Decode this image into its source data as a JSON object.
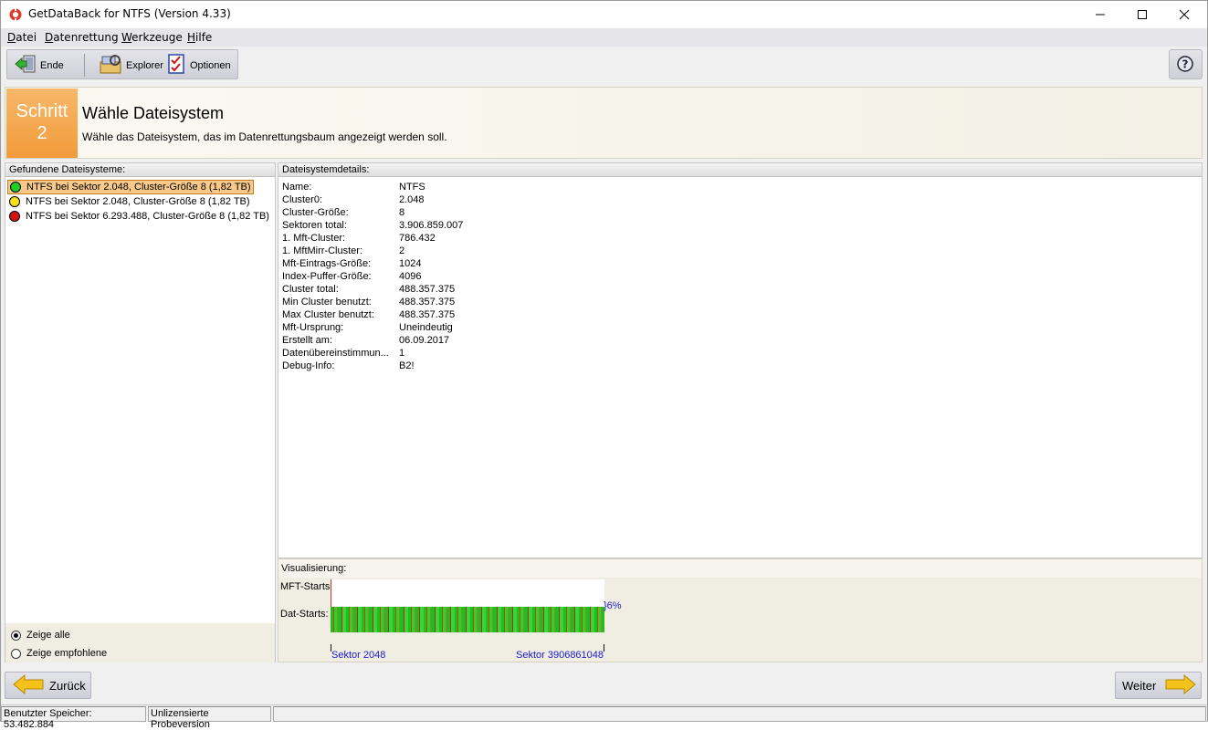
{
  "window": {
    "title": "GetDataBack for NTFS (Version 4.33)"
  },
  "menu": {
    "items": [
      {
        "label": "Datei",
        "accel": "D",
        "rest": "atei"
      },
      {
        "label": "Datenrettung",
        "accel": "D",
        "rest": "atenrettung"
      },
      {
        "label": "Werkzeuge",
        "accel": "W",
        "rest": "erkzeuge"
      },
      {
        "label": "Hilfe",
        "accel": "H",
        "rest": "ilfe"
      }
    ]
  },
  "toolbar": {
    "ende_label": "Ende",
    "explorer_label": "Explorer",
    "optionen_label": "Optionen"
  },
  "step": {
    "badge_word": "Schritt",
    "badge_number": "2",
    "title": "Wähle Dateisystem",
    "subtitle": "Wähle das Dateisystem, das im Datenrettungsbaum angezeigt werden soll."
  },
  "filesystems": {
    "header": "Gefundene Dateisysteme:",
    "items": [
      {
        "label": "NTFS bei Sektor 2.048, Cluster-Größe 8 (1,82 TB)",
        "status": "green",
        "color": "#22cc22"
      },
      {
        "label": "NTFS bei Sektor 2.048, Cluster-Größe 8 (1,82 TB)",
        "status": "yellow",
        "color": "#f2e318"
      },
      {
        "label": "NTFS bei Sektor 6.293.488, Cluster-Größe 8 (1,82 TB)",
        "status": "red",
        "color": "#d21414"
      }
    ],
    "selected_index": 0,
    "show_all_label": "Zeige alle",
    "show_recommended_label": "Zeige empfohlene"
  },
  "details": {
    "header": "Dateisystemdetails:",
    "rows": [
      {
        "key": "Name:",
        "value": "NTFS"
      },
      {
        "key": "Cluster0:",
        "value": "2.048"
      },
      {
        "key": "Cluster-Größe:",
        "value": "8"
      },
      {
        "key": "Sektoren total:",
        "value": "3.906.859.007"
      },
      {
        "key": "1. Mft-Cluster:",
        "value": "786.432"
      },
      {
        "key": "1. MftMirr-Cluster:",
        "value": "2"
      },
      {
        "key": "Mft-Eintrags-Größe:",
        "value": "1024"
      },
      {
        "key": "Index-Puffer-Größe:",
        "value": "4096"
      },
      {
        "key": "Cluster total:",
        "value": "488.357.375"
      },
      {
        "key": "Min Cluster benutzt:",
        "value": "488.357.375"
      },
      {
        "key": "Max Cluster benutzt:",
        "value": "488.357.375"
      },
      {
        "key": "Mft-Ursprung:",
        "value": "Uneindeutig"
      },
      {
        "key": "Erstellt am:",
        "value": "06.09.2017"
      },
      {
        "key": "Datenübereinstimmun...",
        "value": "1"
      },
      {
        "key": "Debug-Info:",
        "value": "B2!"
      }
    ]
  },
  "visualization": {
    "header": "Visualisierung:",
    "mft_label": "MFT-Starts",
    "dat_label": "Dat-Starts:",
    "percent": "}6%",
    "sector_start": "Sektor 2048",
    "sector_end": "Sektor 3906861048"
  },
  "nav": {
    "back_label": "Zurück",
    "next_label": "Weiter"
  },
  "status": {
    "memory": "Benutzter Speicher: 53.482.884",
    "license": "Unlizensierte Probeversion"
  }
}
